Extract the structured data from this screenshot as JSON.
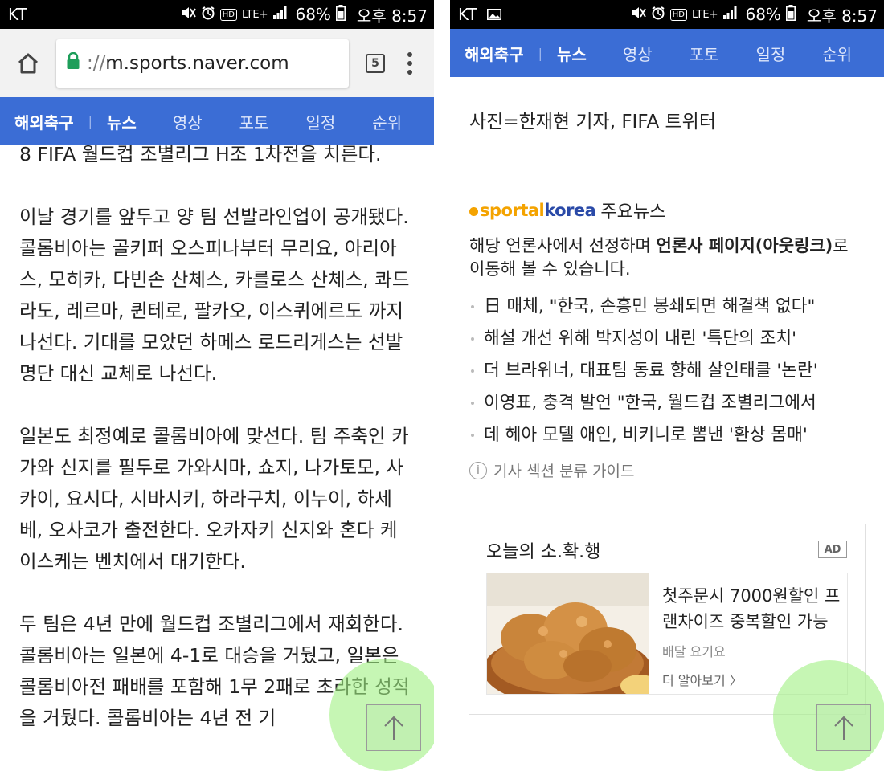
{
  "left_screen": {
    "status": {
      "carrier": "KT",
      "network": "LTE+",
      "battery": "68%",
      "time": "오후 8:57"
    },
    "browser": {
      "home_icon": "home-icon",
      "url_scheme": "://",
      "url_host": "m.sports.naver.com",
      "tab_count": "5"
    },
    "nav": {
      "brand": "해외축구",
      "tabs": [
        "뉴스",
        "영상",
        "포토",
        "일정",
        "순위"
      ],
      "active_index": 0
    },
    "article": {
      "paragraphs": [
        "8 FIFA 월드컵 조별리그 H조 1차전을 치른다.",
        "이날 경기를 앞두고 양 팀 선발라인업이 공개됐다. 콜롬비아는 골키퍼 오스피나부터 무리요, 아리아스, 모히카, 다빈손 산체스, 카를로스 산체스, 콰드라도, 레르마, 퀸테로, 팔카오, 이스퀴에르도 까지 나선다. 기대를 모았던 하메스 로드리게스는 선발 명단 대신 교체로 나선다.",
        "일본도 최정예로 콜롬비아에 맞선다. 팀 주축인 카가와 신지를 필두로 가와시마, 쇼지, 나가토모, 사카이, 요시다, 시바시키, 하라구치, 이누이, 하세베, 오사코가 출전한다. 오카자키 신지와 혼다 케이스케는 벤치에서 대기한다.",
        "두 팀은 4년 만에 월드컵 조별리그에서 재회한다. 콜롬비아는 일본에 4-1로 대승을 거뒀고, 일본은 콜롬비아전 패배를 포함해 1무 2패로 초라한 성적을 거뒀다. 콜롬비아는 4년 전 기"
      ]
    }
  },
  "right_screen": {
    "status": {
      "carrier": "KT",
      "network": "LTE+",
      "battery": "68%",
      "time": "오후 8:57"
    },
    "nav": {
      "brand": "해외축구",
      "tabs": [
        "뉴스",
        "영상",
        "포토",
        "일정",
        "순위"
      ],
      "active_index": 0
    },
    "caption": "사진=한재현 기자, FIFA 트위터",
    "news": {
      "logo_part1": "sportal",
      "logo_part2": "korea",
      "title": "주요뉴스",
      "desc_before": "해당 언론사에서 선정하며 ",
      "desc_bold": "언론사 페이지(아웃링크)",
      "desc_after": "로 이동해 볼 수 있습니다.",
      "items": [
        "日 매체, \"한국, 손흥민 봉쇄되면 해결책 없다\"",
        "해설 개선 위해 박지성이 내린 '특단의 조치'",
        "더 브라위너, 대표팀 동료 향해 살인태클 '논란'",
        "이영표, 충격 발언 \"한국, 월드컵 조별리그에서",
        "데 헤아 모델 애인, 비키니로 뽐낸 '환상 몸매'"
      ],
      "guide": "기사 섹션 분류 가이드"
    },
    "ad": {
      "title": "오늘의 소.확.행",
      "badge": "AD",
      "headline": "첫주문시 7000원할인 프랜차이즈 중복할인 가능",
      "source": "배달 요기요",
      "more": "더 알아보기 〉"
    }
  },
  "colors": {
    "nav_blue": "#3b6dd5",
    "lock_green": "#1e9e5a",
    "fab_glow": "#a0f082"
  }
}
